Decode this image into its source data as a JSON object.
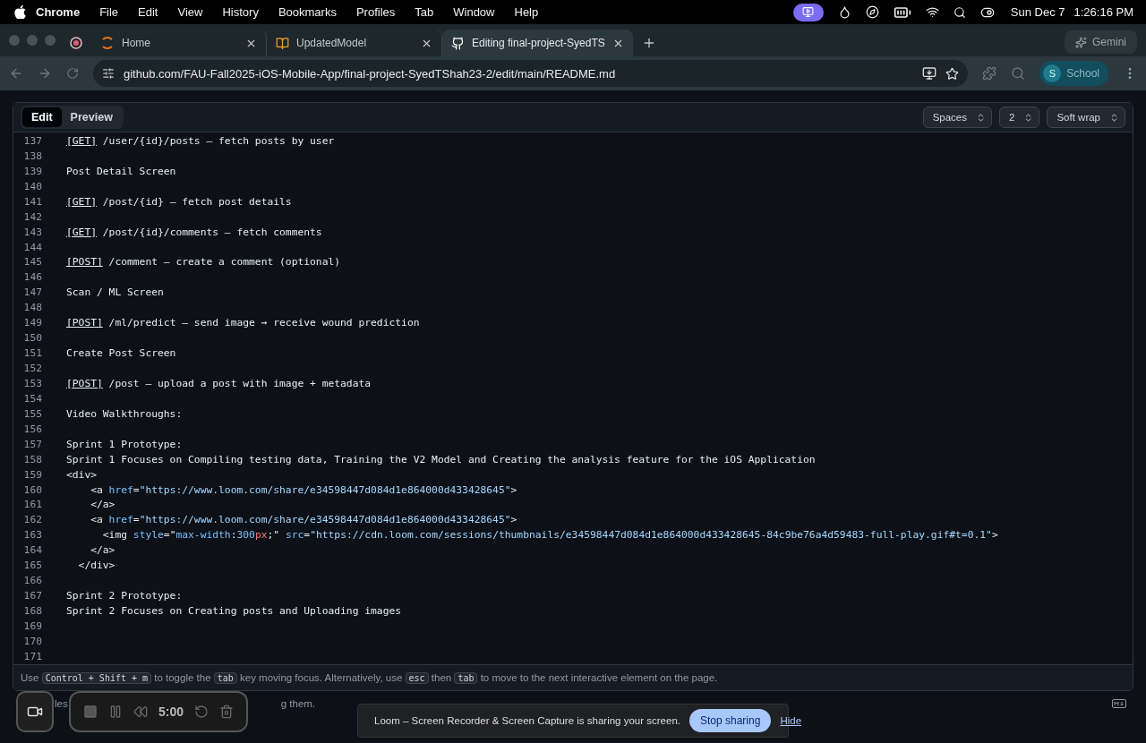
{
  "menu_bar": {
    "app": "Chrome",
    "items": [
      "File",
      "Edit",
      "View",
      "History",
      "Bookmarks",
      "Profiles",
      "Tab",
      "Window",
      "Help"
    ],
    "date": "Sun Dec 7",
    "time": "1:26:16 PM"
  },
  "tabs": [
    {
      "kind": "home",
      "title": "Home",
      "selected": false
    },
    {
      "kind": "book",
      "title": "UpdatedModel",
      "selected": false
    },
    {
      "kind": "github",
      "title": "Editing final-project-SyedTS",
      "selected": true
    }
  ],
  "gemini": "Gemini",
  "address": "github.com/FAU-Fall2025-iOS-Mobile-App/final-project-SyedTShah23-2/edit/main/README.md",
  "profile": {
    "initial": "S",
    "name": "School"
  },
  "editor": {
    "modes": [
      {
        "label": "Edit",
        "selected": true
      },
      {
        "label": "Preview",
        "selected": false
      }
    ],
    "selects": [
      "Spaces",
      "2",
      "Soft wrap"
    ],
    "lines": [
      {
        "number": "137",
        "tokens": [
          {
            "kind": "method",
            "text": "[GET]"
          },
          {
            "kind": "text",
            "text": " /user/{id}/posts – fetch posts by user"
          }
        ]
      },
      {
        "number": "138"
      },
      {
        "number": "139",
        "tokens": [
          {
            "kind": "text",
            "text": "Post Detail Screen"
          }
        ]
      },
      {
        "number": "140"
      },
      {
        "number": "141",
        "tokens": [
          {
            "kind": "method",
            "text": "[GET]"
          },
          {
            "kind": "text",
            "text": " /post/{id} – fetch post details"
          }
        ]
      },
      {
        "number": "142"
      },
      {
        "number": "143",
        "tokens": [
          {
            "kind": "method",
            "text": "[GET]"
          },
          {
            "kind": "text",
            "text": " /post/{id}/comments – fetch comments"
          }
        ]
      },
      {
        "number": "144"
      },
      {
        "number": "145",
        "tokens": [
          {
            "kind": "method",
            "text": "[POST]"
          },
          {
            "kind": "text",
            "text": " /comment – create a comment (optional)"
          }
        ]
      },
      {
        "number": "146"
      },
      {
        "number": "147",
        "tokens": [
          {
            "kind": "text",
            "text": "Scan / ML Screen"
          }
        ]
      },
      {
        "number": "148"
      },
      {
        "number": "149",
        "tokens": [
          {
            "kind": "method",
            "text": "[POST]"
          },
          {
            "kind": "text",
            "text": " /ml/predict – send image → receive wound prediction"
          }
        ]
      },
      {
        "number": "150"
      },
      {
        "number": "151",
        "tokens": [
          {
            "kind": "text",
            "text": "Create Post Screen"
          }
        ]
      },
      {
        "number": "152"
      },
      {
        "number": "153",
        "tokens": [
          {
            "kind": "method",
            "text": "[POST]"
          },
          {
            "kind": "text",
            "text": " /post – upload a post with image + metadata"
          }
        ]
      },
      {
        "number": "154"
      },
      {
        "number": "155",
        "tokens": [
          {
            "kind": "text",
            "text": "Video Walkthroughs:"
          }
        ]
      },
      {
        "number": "156"
      },
      {
        "number": "157",
        "tokens": [
          {
            "kind": "text",
            "text": "Sprint 1 Prototype:"
          }
        ]
      },
      {
        "number": "158",
        "tokens": [
          {
            "kind": "text",
            "text": "Sprint 1 Focuses on Compiling testing data, Training the V2 Model and Creating the analysis feature for the iOS Application"
          }
        ]
      },
      {
        "number": "159",
        "tokens": [
          {
            "kind": "tag",
            "text": "<div>"
          }
        ]
      },
      {
        "number": "160",
        "tokens": [
          {
            "kind": "tag",
            "text": "    <a "
          },
          {
            "kind": "attr",
            "text": "href"
          },
          {
            "kind": "text",
            "text": "="
          },
          {
            "kind": "string",
            "text": "\"https://www.loom.com/share/e34598447d084d1e864000d433428645\""
          },
          {
            "kind": "tag",
            "text": ">"
          }
        ]
      },
      {
        "number": "161",
        "tokens": [
          {
            "kind": "tag",
            "text": "    </a>"
          }
        ]
      },
      {
        "number": "162",
        "tokens": [
          {
            "kind": "tag",
            "text": "    <a "
          },
          {
            "kind": "attr",
            "text": "href"
          },
          {
            "kind": "text",
            "text": "="
          },
          {
            "kind": "string",
            "text": "\"https://www.loom.com/share/e34598447d084d1e864000d433428645\""
          },
          {
            "kind": "tag",
            "text": ">"
          }
        ]
      },
      {
        "number": "163",
        "tokens": [
          {
            "kind": "tag",
            "text": "      <img "
          },
          {
            "kind": "attr",
            "text": "style"
          },
          {
            "kind": "text",
            "text": "=\""
          },
          {
            "kind": "attr",
            "text": "max-width"
          },
          {
            "kind": "text",
            "text": ":"
          },
          {
            "kind": "number",
            "text": "300"
          },
          {
            "kind": "unit",
            "text": "px"
          },
          {
            "kind": "text",
            "text": ";\" "
          },
          {
            "kind": "attr",
            "text": "src"
          },
          {
            "kind": "text",
            "text": "="
          },
          {
            "kind": "string",
            "text": "\"https://cdn.loom.com/sessions/thumbnails/e34598447d084d1e864000d433428645-84c9be76a4d59483-full-play.gif#t=0.1\""
          },
          {
            "kind": "tag",
            "text": ">"
          }
        ]
      },
      {
        "number": "164",
        "tokens": [
          {
            "kind": "tag",
            "text": "    </a>"
          }
        ]
      },
      {
        "number": "165",
        "tokens": [
          {
            "kind": "tag",
            "text": "  </div>"
          }
        ]
      },
      {
        "number": "166"
      },
      {
        "number": "167",
        "tokens": [
          {
            "kind": "text",
            "text": "Sprint 2 Prototype:"
          }
        ]
      },
      {
        "number": "168",
        "tokens": [
          {
            "kind": "text",
            "text": "Sprint 2 Focuses on Creating posts and Uploading images"
          }
        ]
      },
      {
        "number": "169"
      },
      {
        "number": "170"
      },
      {
        "number": "171"
      }
    ],
    "help": [
      {
        "kind": "text",
        "text": "Use "
      },
      {
        "kind": "key",
        "text": "Control + Shift + m"
      },
      {
        "kind": "text",
        "text": " to toggle the "
      },
      {
        "kind": "key",
        "text": "tab"
      },
      {
        "kind": "text",
        "text": " key moving focus. Alternatively, use "
      },
      {
        "kind": "key",
        "text": "esc"
      },
      {
        "kind": "text",
        "text": " then "
      },
      {
        "kind": "key",
        "text": "tab"
      },
      {
        "kind": "text",
        "text": " to move to the next interactive element on the page."
      }
    ],
    "footer_parts": [
      "les",
      "g them."
    ]
  },
  "recorder": {
    "timer": "5:00"
  },
  "sharing_banner": {
    "message": "Loom – Screen Recorder & Screen Capture is sharing your screen.",
    "stop": "Stop sharing",
    "hide": "Hide"
  }
}
